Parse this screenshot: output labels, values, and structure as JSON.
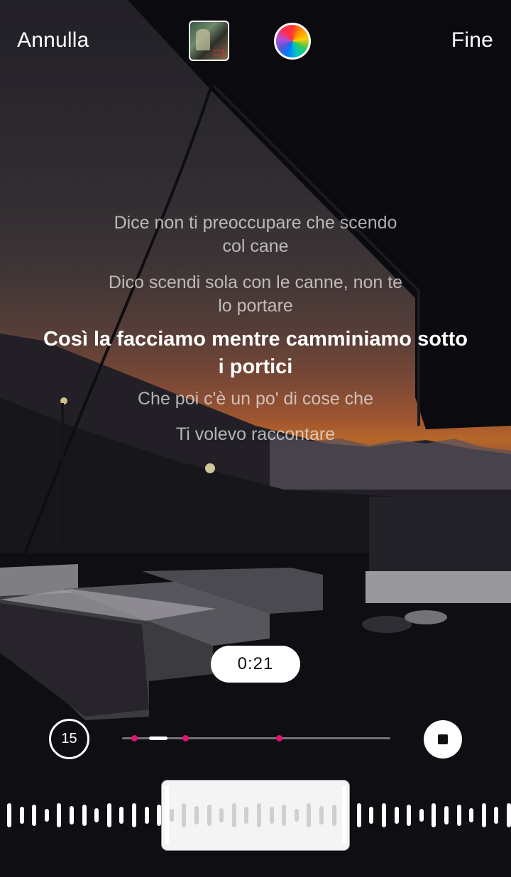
{
  "header": {
    "cancel_label": "Annulla",
    "done_label": "Fine",
    "album_thumbnail_icon": "album-cover-icon",
    "color_picker_icon": "color-wheel-icon"
  },
  "lyrics": [
    {
      "lines": [
        "Dice non ti preoccupare che scendo",
        "col cane"
      ],
      "active": false
    },
    {
      "lines": [
        "Dico scendi sola con le canne, non te",
        "lo portare"
      ],
      "active": false
    },
    {
      "lines": [
        "Così la facciamo mentre camminiamo sotto",
        "i portici"
      ],
      "active": true
    },
    {
      "lines": [
        "Che poi c'è un po' di cose che"
      ],
      "active": false
    },
    {
      "lines": [
        "Ti volevo raccontare"
      ],
      "active": false
    }
  ],
  "playback": {
    "current_time": "0:21",
    "skip_label": "15",
    "skip_icon": "skip-15-icon",
    "stop_icon": "stop-icon",
    "progress_fraction_start": 0.1,
    "progress_fraction_end": 0.17,
    "marker_fractions": [
      0.046,
      0.235,
      0.585
    ],
    "accent_color": "#e3146f"
  }
}
